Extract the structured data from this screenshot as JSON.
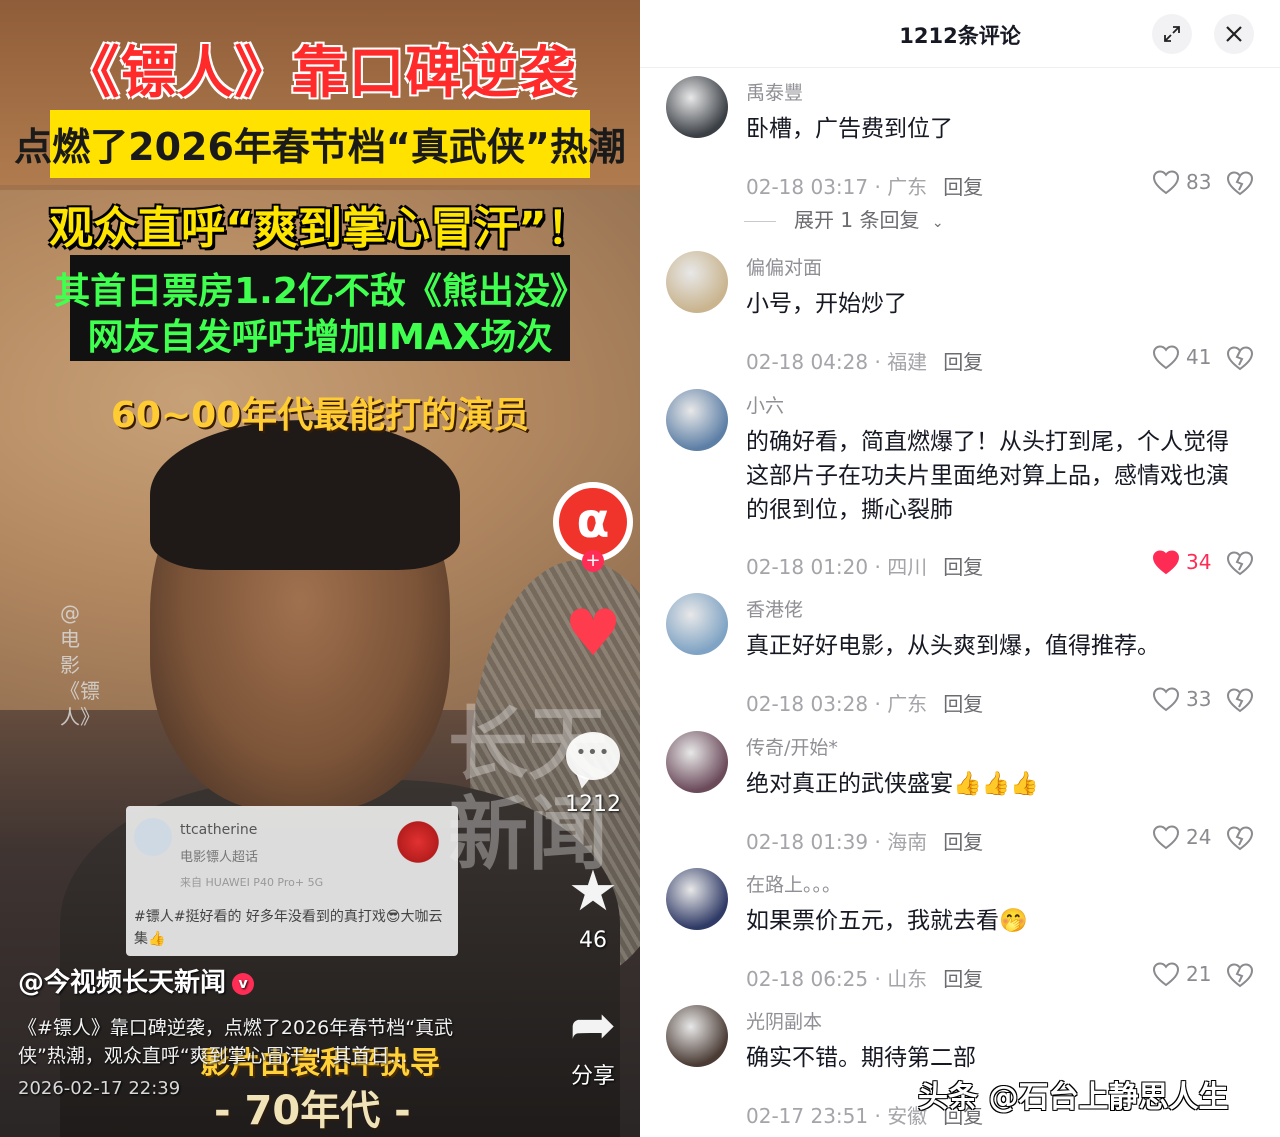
{
  "video": {
    "headline_1": "《镖人》靠口碑逆袭",
    "headline_2": "点燃了2026年春节档“真武侠”热潮",
    "headline_3": "观众直呼“爽到掌心冒汗”！",
    "headline_4a": "其首日票房1.2亿不敌《熊出没》",
    "headline_4b": "网友自发呼吁增加IMAX场次",
    "headline_5": "60~00年代最能打的演员",
    "vertical_tag": "@电影《镖人》",
    "watermark": "长天新闻",
    "inset_card": {
      "name": "ttcatherine",
      "sub": "电影镖人超话",
      "meta": "来自 HUAWEI P40 Pro+ 5G",
      "body": "#镖人#挺好看的 好多年没看到的真打戏😎大咖云集👍"
    },
    "author": "@今视频长天新闻",
    "caption": "《#镖人》靠口碑逆袭，点燃了2026年春节档“真武侠”热潮，观众直呼“爽到掌心冒汗”！其首日...",
    "date": "2026-02-17 22:39",
    "bottom_sub_1": "影片由袁和平执导",
    "bottom_sub_2": "- 70年代 -",
    "rail": {
      "comment_count": "1212",
      "favorite_count": "46",
      "share_label": "分享"
    }
  },
  "comments_panel": {
    "title": "1212条评论",
    "expand_icon": "expand-icon",
    "close_icon": "close-icon",
    "reply_label": "回复",
    "items": [
      {
        "user": "禹泰豐",
        "text": "卧槽，广告费到位了",
        "time": "02-18 03:17",
        "region": "广东",
        "likes": "83",
        "liked": false,
        "avatar_color": "#3a3f45"
      },
      {
        "user": "偏偏对面",
        "text": "小号，开始炒了",
        "time": "02-18 04:28",
        "region": "福建",
        "likes": "41",
        "liked": false,
        "avatar_color": "#c9b48e"
      },
      {
        "user": "小六",
        "text": "的确好看，简直燃爆了！从头打到尾，个人觉得这部片子在功夫片里面绝对算上品，感情戏也演的很到位，撕心裂肺",
        "time": "02-18 01:20",
        "region": "四川",
        "likes": "34",
        "liked": true,
        "avatar_color": "#5d7fa6"
      },
      {
        "user": "香港佬",
        "text": "真正好好电影，从头爽到爆，值得推荐。",
        "time": "02-18 03:28",
        "region": "广东",
        "likes": "33",
        "liked": false,
        "avatar_color": "#7fa3c4"
      },
      {
        "user": "传奇/开始*",
        "text": "绝对真正的武侠盛宴👍👍👍",
        "time": "02-18 01:39",
        "region": "海南",
        "likes": "24",
        "liked": false,
        "avatar_color": "#6b4a5a"
      },
      {
        "user": "在路上。。。",
        "text": "如果票价五元，我就去看🤭",
        "time": "02-18 06:25",
        "region": "山东",
        "likes": "21",
        "liked": false,
        "avatar_color": "#2f3a66"
      },
      {
        "user": "光阴副本",
        "text": "确实不错。期待第二部",
        "time": "02-17 23:51",
        "region": "安徽",
        "likes": "",
        "liked": false,
        "avatar_color": "#4a3b34"
      }
    ],
    "expand_replies": "展开 1 条回复"
  },
  "site_watermark": "头条 @石台上静思人生",
  "colors": {
    "accent": "#fe2c55",
    "text": "#161823",
    "muted": "#a4a4a9"
  }
}
